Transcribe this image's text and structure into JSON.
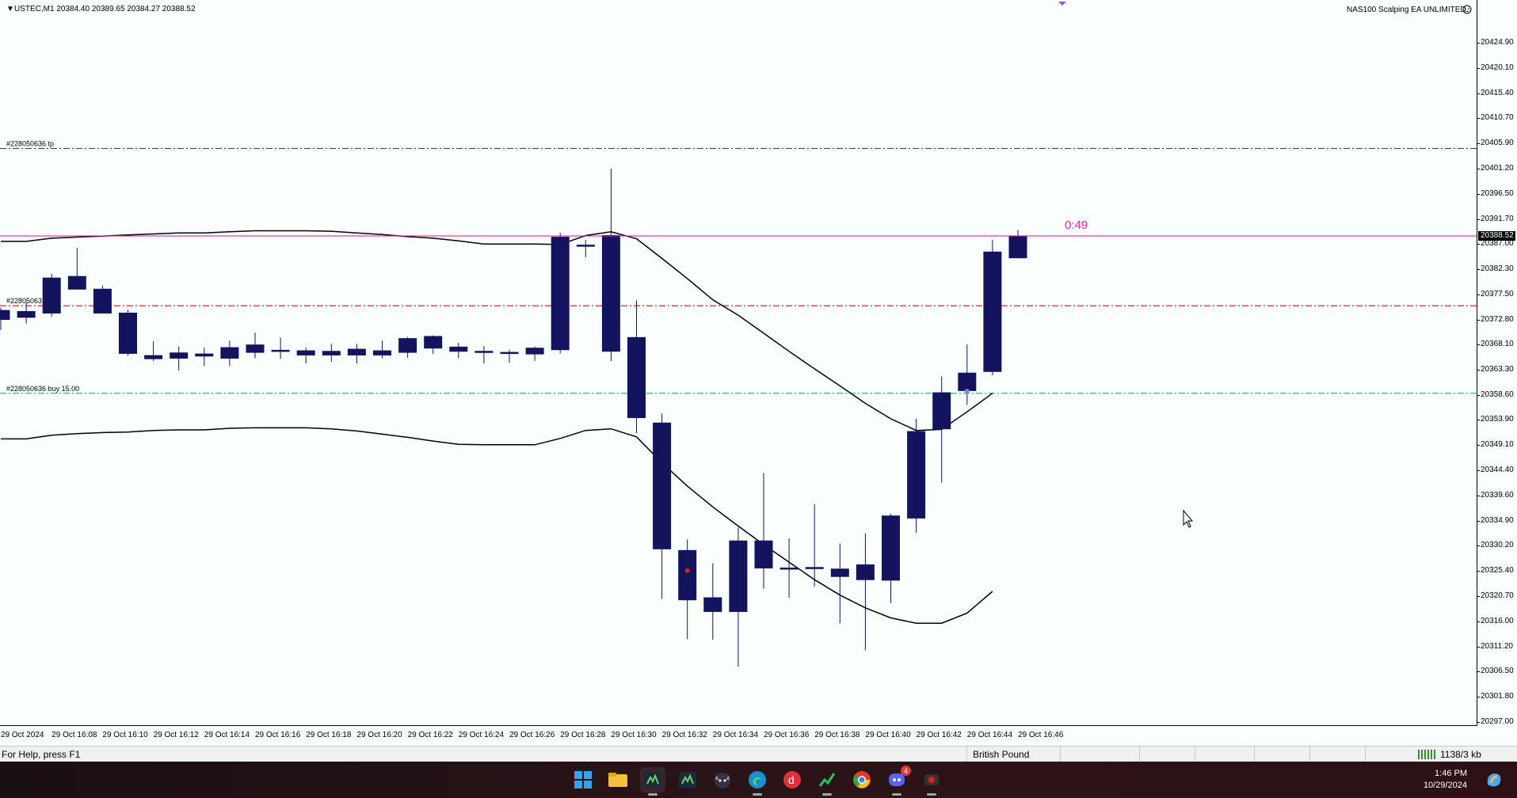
{
  "chart": {
    "symbol_line": "USTEC,M1  20384.40 20389.65 20384.27 20388.52",
    "expert_label": "NAS100 Scalping EA UNLIMITED",
    "countdown": "0:49",
    "current_price_label": "20388.52",
    "orders": [
      {
        "label": "#228050636 tp",
        "price": 20405.0,
        "color": "#c00000"
      },
      {
        "label": "#22805063",
        "price": 20375.4,
        "color": "#c00000"
      },
      {
        "label": "#228050636 buy 15.00",
        "price": 20358.9,
        "color": "#00b050"
      }
    ],
    "bid_line_price": 20388.52,
    "colors": {
      "candle": "#14145e",
      "bands": "#000000",
      "bid": "#ff00aa",
      "tp": "#c00000",
      "buy": "#00b050",
      "countdown": "#e020b0"
    },
    "price_ticks": [
      "20424.90",
      "20420.10",
      "20415.40",
      "20410.70",
      "20405.90",
      "20401.20",
      "20396.50",
      "20391.70",
      "20387.00",
      "20382.30",
      "20377.50",
      "20372.80",
      "20368.10",
      "20363.30",
      "20358.60",
      "20353.90",
      "20349.10",
      "20344.40",
      "20339.60",
      "20334.90",
      "20330.20",
      "20325.40",
      "20320.70",
      "20316.00",
      "20311.20",
      "20306.50",
      "20301.80",
      "20297.00"
    ],
    "time_ticks": [
      "29 Oct 2024",
      "29 Oct 16:08",
      "29 Oct 16:10",
      "29 Oct 16:12",
      "29 Oct 16:14",
      "29 Oct 16:16",
      "29 Oct 16:18",
      "29 Oct 16:20",
      "29 Oct 16:22",
      "29 Oct 16:24",
      "29 Oct 16:26",
      "29 Oct 16:28",
      "29 Oct 16:30",
      "29 Oct 16:32",
      "29 Oct 16:34",
      "29 Oct 16:36",
      "29 Oct 16:38",
      "29 Oct 16:40",
      "29 Oct 16:42",
      "29 Oct 16:44",
      "29 Oct 16:46"
    ]
  },
  "chart_data": {
    "type": "candlestick",
    "symbol": "USTEC",
    "timeframe": "M1",
    "ylim": [
      20297.0,
      20424.9
    ],
    "candles": [
      {
        "o": 20372.8,
        "h": 20375.0,
        "l": 20370.8,
        "c": 20374.5
      },
      {
        "o": 20373.2,
        "h": 20376.0,
        "l": 20372.0,
        "c": 20374.3
      },
      {
        "o": 20374.0,
        "h": 20381.4,
        "l": 20373.3,
        "c": 20380.6
      },
      {
        "o": 20380.9,
        "h": 20386.3,
        "l": 20378.5,
        "c": 20378.5
      },
      {
        "o": 20378.5,
        "h": 20379.2,
        "l": 20374.0,
        "c": 20374.0
      },
      {
        "o": 20374.0,
        "h": 20374.6,
        "l": 20366.0,
        "c": 20366.4
      },
      {
        "o": 20366.0,
        "h": 20368.7,
        "l": 20365.0,
        "c": 20365.4
      },
      {
        "o": 20365.5,
        "h": 20367.7,
        "l": 20363.2,
        "c": 20366.5
      },
      {
        "o": 20366.3,
        "h": 20367.5,
        "l": 20364.0,
        "c": 20365.9
      },
      {
        "o": 20365.5,
        "h": 20368.8,
        "l": 20364.0,
        "c": 20367.5
      },
      {
        "o": 20366.6,
        "h": 20370.3,
        "l": 20365.5,
        "c": 20368.0
      },
      {
        "o": 20367.0,
        "h": 20369.4,
        "l": 20365.4,
        "c": 20367.0
      },
      {
        "o": 20366.1,
        "h": 20367.5,
        "l": 20364.5,
        "c": 20366.9
      },
      {
        "o": 20366.1,
        "h": 20368.2,
        "l": 20364.8,
        "c": 20366.8
      },
      {
        "o": 20366.1,
        "h": 20368.2,
        "l": 20364.5,
        "c": 20367.2
      },
      {
        "o": 20366.1,
        "h": 20368.8,
        "l": 20365.5,
        "c": 20366.9
      },
      {
        "o": 20366.6,
        "h": 20369.5,
        "l": 20365.6,
        "c": 20369.2
      },
      {
        "o": 20367.4,
        "h": 20369.8,
        "l": 20366.3,
        "c": 20369.6
      },
      {
        "o": 20366.8,
        "h": 20368.4,
        "l": 20365.5,
        "c": 20367.6
      },
      {
        "o": 20366.8,
        "h": 20367.8,
        "l": 20364.5,
        "c": 20366.8
      },
      {
        "o": 20366.6,
        "h": 20367.1,
        "l": 20364.6,
        "c": 20366.6
      },
      {
        "o": 20366.3,
        "h": 20367.7,
        "l": 20365.0,
        "c": 20367.4
      },
      {
        "o": 20367.1,
        "h": 20389.1,
        "l": 20366.4,
        "c": 20388.3
      },
      {
        "o": 20386.8,
        "h": 20387.8,
        "l": 20384.5,
        "c": 20386.6
      },
      {
        "o": 20388.6,
        "h": 20401.2,
        "l": 20365.0,
        "c": 20366.8
      },
      {
        "o": 20369.4,
        "h": 20376.4,
        "l": 20351.4,
        "c": 20354.3
      },
      {
        "o": 20353.3,
        "h": 20355.1,
        "l": 20320.2,
        "c": 20329.6
      },
      {
        "o": 20329.3,
        "h": 20331.4,
        "l": 20312.6,
        "c": 20320.0
      },
      {
        "o": 20320.4,
        "h": 20326.9,
        "l": 20312.5,
        "c": 20317.8
      },
      {
        "o": 20317.8,
        "h": 20333.6,
        "l": 20307.4,
        "c": 20331.1
      },
      {
        "o": 20331.1,
        "h": 20343.9,
        "l": 20322.1,
        "c": 20326.0
      },
      {
        "o": 20326.0,
        "h": 20331.6,
        "l": 20320.4,
        "c": 20326.0
      },
      {
        "o": 20326.1,
        "h": 20338.0,
        "l": 20322.5,
        "c": 20326.0
      },
      {
        "o": 20325.8,
        "h": 20330.6,
        "l": 20315.6,
        "c": 20324.4
      },
      {
        "o": 20323.8,
        "h": 20332.5,
        "l": 20310.5,
        "c": 20326.6
      },
      {
        "o": 20323.7,
        "h": 20336.2,
        "l": 20319.4,
        "c": 20335.8
      },
      {
        "o": 20335.4,
        "h": 20354.1,
        "l": 20332.6,
        "c": 20351.7
      },
      {
        "o": 20352.2,
        "h": 20362.1,
        "l": 20342.1,
        "c": 20359.0
      },
      {
        "o": 20359.4,
        "h": 20368.1,
        "l": 20356.7,
        "c": 20362.7
      },
      {
        "o": 20363.0,
        "h": 20387.8,
        "l": 20362.3,
        "c": 20385.5
      },
      {
        "o": 20384.4,
        "h": 20389.65,
        "l": 20384.27,
        "c": 20388.52
      }
    ],
    "bands": {
      "upper": [
        20387.5,
        20387.5,
        20388.1,
        20388.3,
        20388.5,
        20388.7,
        20388.9,
        20389.1,
        20389.1,
        20389.3,
        20389.5,
        20389.5,
        20389.5,
        20389.4,
        20389.1,
        20388.8,
        20388.4,
        20388.1,
        20387.6,
        20387.0,
        20387.0,
        20387.0,
        20386.9,
        20388.6,
        20389.3,
        20388.0,
        20384.3,
        20380.5,
        20376.5,
        20373.6,
        20370.2,
        20366.8,
        20363.5,
        20360.3,
        20357.0,
        20354.1,
        20351.9,
        20352.1,
        20355.4,
        20358.9
      ],
      "lower": [
        20350.3,
        20350.3,
        20351.0,
        20351.3,
        20351.5,
        20351.6,
        20351.9,
        20352.0,
        20352.0,
        20352.3,
        20352.4,
        20352.4,
        20352.4,
        20352.2,
        20351.8,
        20351.2,
        20350.6,
        20349.9,
        20349.3,
        20349.2,
        20349.2,
        20349.2,
        20350.4,
        20351.9,
        20352.2,
        20350.7,
        20345.8,
        20341.4,
        20337.5,
        20333.9,
        20330.4,
        20327.1,
        20323.8,
        20320.9,
        20318.5,
        20316.6,
        20315.6,
        20315.6,
        20317.5,
        20321.6
      ]
    }
  },
  "status": {
    "help_text": "For Help, press F1",
    "profile": "British Pound",
    "traffic": "1138/3 kb"
  },
  "taskbar": {
    "time": "1:46 PM",
    "date": "10/29/2024",
    "icons": [
      "windows-start-icon",
      "file-explorer-icon",
      "metatrader-icon",
      "metatrader-icon-2",
      "cat-app-icon",
      "edge-icon",
      "red-app-icon",
      "chart-app-icon",
      "chrome-icon",
      "discord-icon",
      "record-icon"
    ],
    "discord_badge": "4"
  }
}
